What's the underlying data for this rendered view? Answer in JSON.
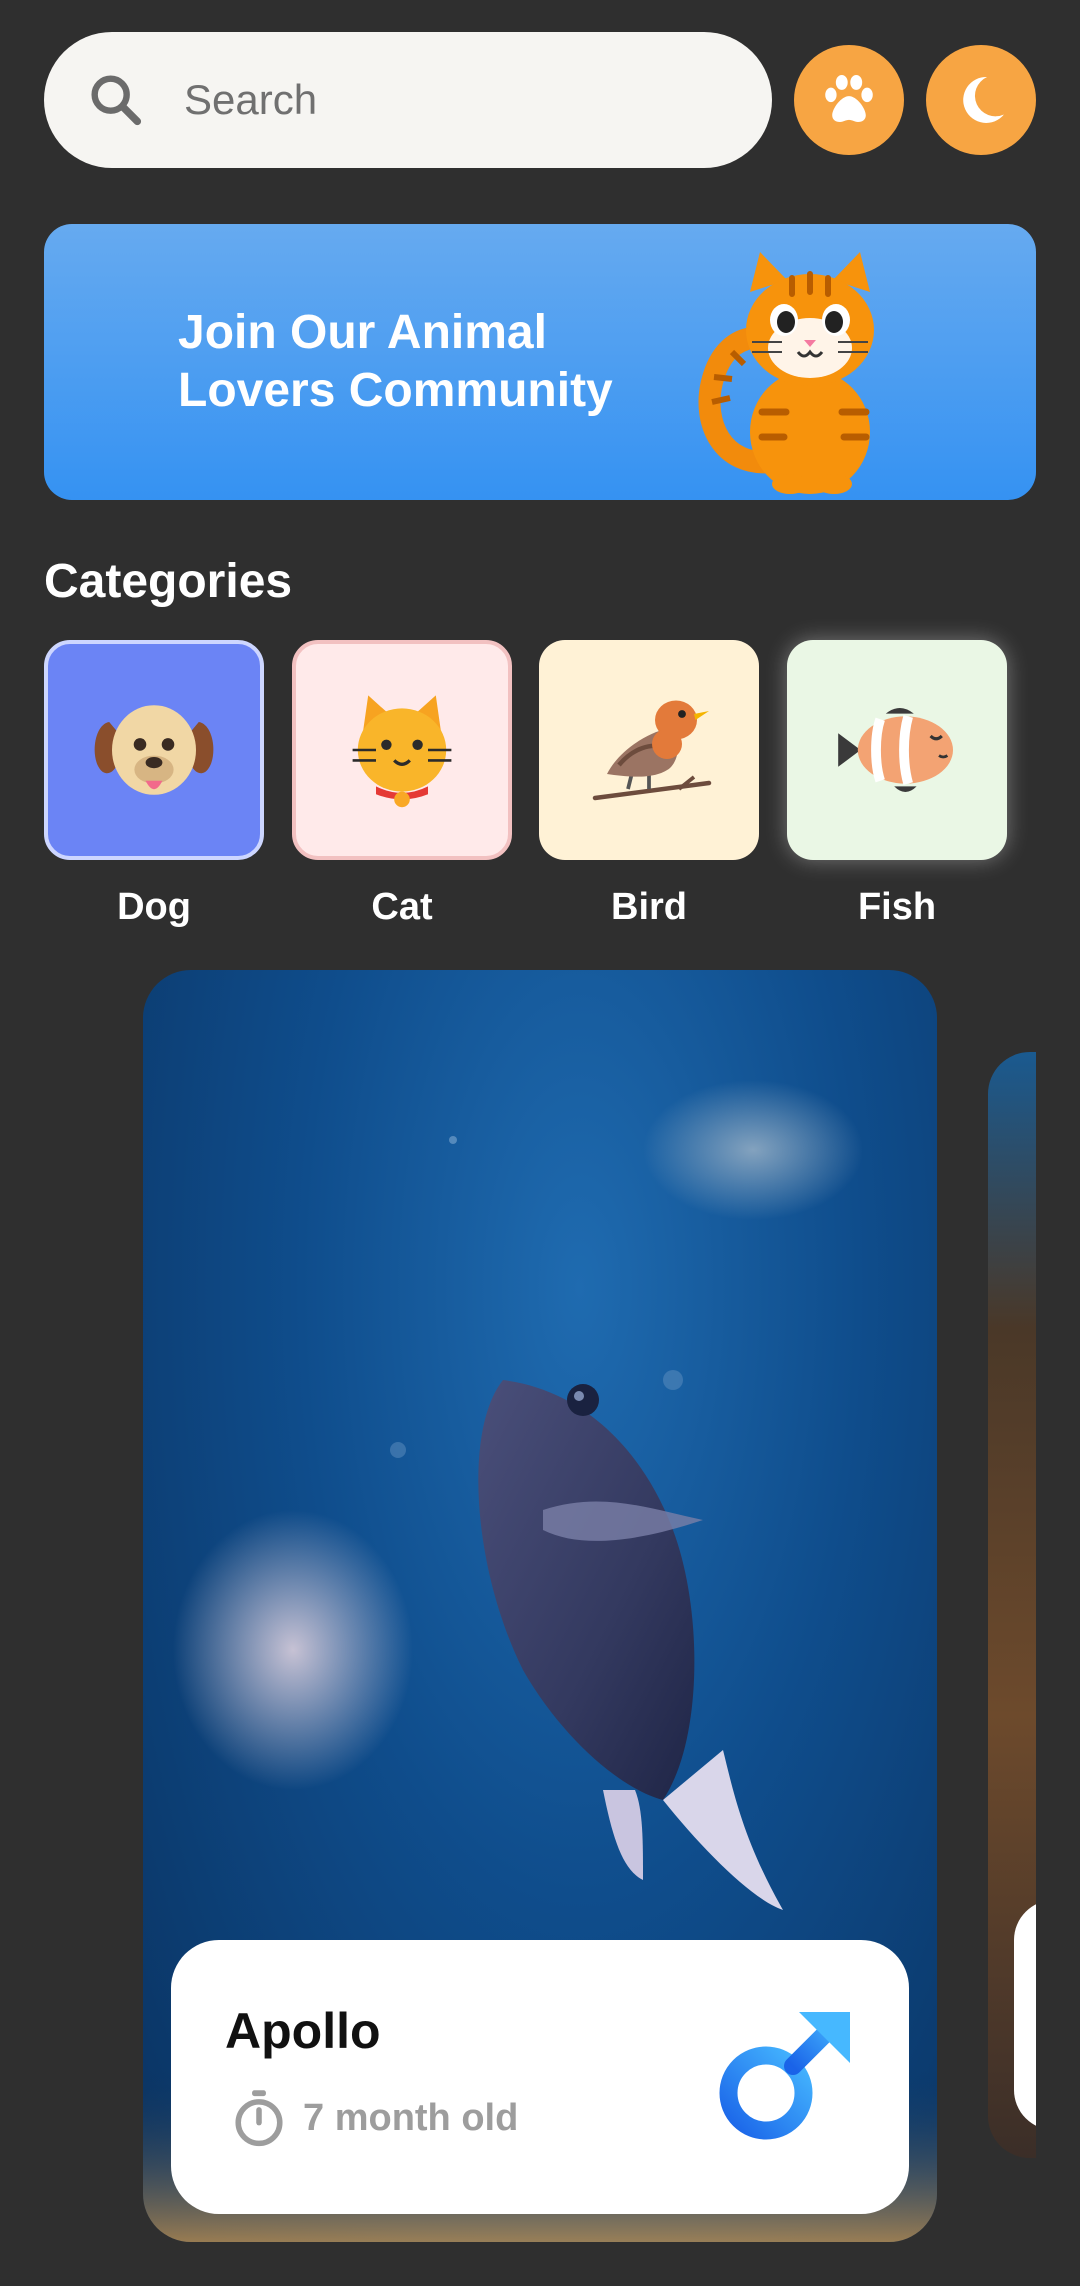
{
  "search": {
    "placeholder": "Search",
    "value": ""
  },
  "header_buttons": {
    "paw_icon": "paw-icon",
    "theme_icon": "moon-icon",
    "accent_color": "#f7a543"
  },
  "banner": {
    "title_line1": "Join Our Animal",
    "title_line2": "Lovers Community",
    "colors": [
      "#66aaf0",
      "#3592f2"
    ]
  },
  "categories": {
    "title": "Categories",
    "items": [
      {
        "label": "Dog",
        "icon": "dog-icon",
        "selected": true
      },
      {
        "label": "Cat",
        "icon": "cat-icon",
        "selected": false
      },
      {
        "label": "Bird",
        "icon": "bird-icon",
        "selected": false
      },
      {
        "label": "Fish",
        "icon": "fish-icon",
        "selected": false
      }
    ]
  },
  "pets": [
    {
      "name": "Apollo",
      "age": "7 month old",
      "gender_icon": "male-icon",
      "gender_color": "#1f7bf0"
    }
  ]
}
